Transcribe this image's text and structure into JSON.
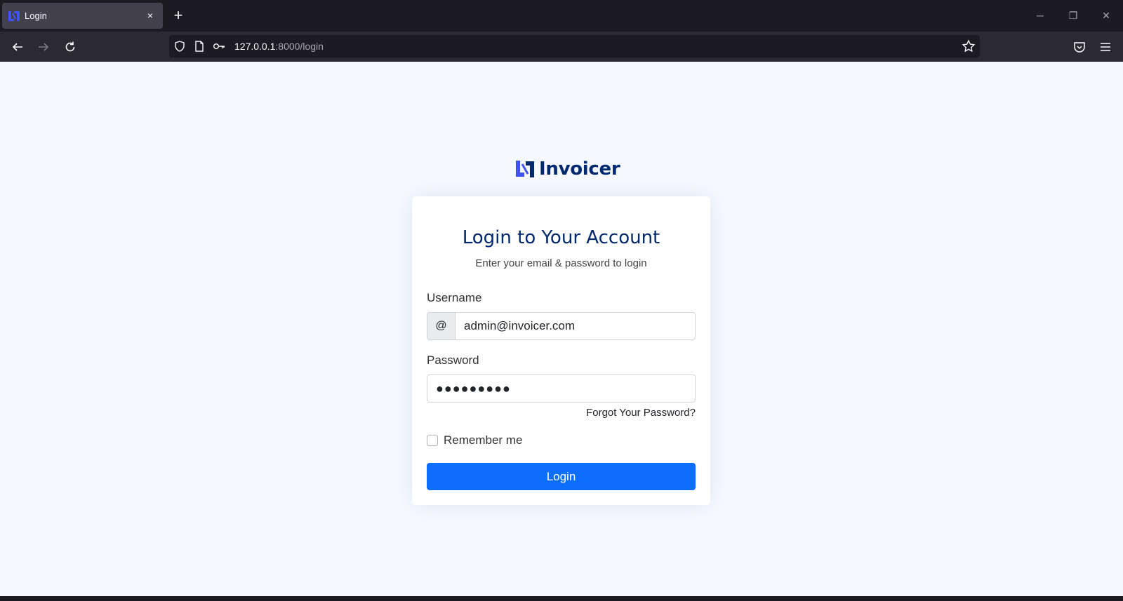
{
  "browser": {
    "tab_title": "Login",
    "tab_close": "×",
    "new_tab": "+",
    "url_host": "127.0.0.1",
    "url_path": ":8000/login",
    "window_controls": {
      "minimize": "─",
      "restore": "❐",
      "close": "✕"
    }
  },
  "page": {
    "brand": "Invoicer",
    "title": "Login to Your Account",
    "subtitle": "Enter your email & password to login",
    "username_label": "Username",
    "username_prefix": "@",
    "username_value": "admin@invoicer.com",
    "password_label": "Password",
    "password_value": "●●●●●●●●●",
    "forgot_link": "Forgot Your Password?",
    "remember_label": "Remember me",
    "login_button": "Login"
  },
  "colors": {
    "brand": "#012970",
    "primary": "#0d6efd",
    "logo_accent": "#4154f1",
    "page_bg": "#f6f9ff"
  }
}
